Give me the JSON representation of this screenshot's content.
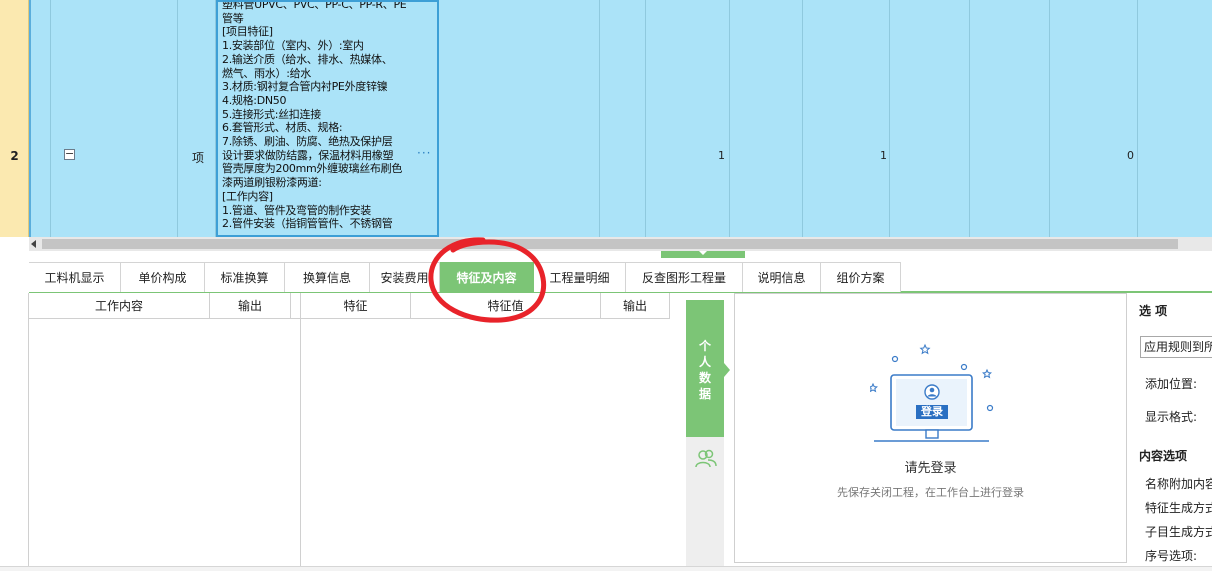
{
  "grid": {
    "row_number": "2",
    "expand_glyph": "−",
    "unit": "项",
    "description": "塑料管UPVC、PVC、PP-C、PP-R、PE\n管等\n[项目特征]\n1.安装部位（室内、外）:室内\n2.输送介质（给水、排水、热媒体、\n燃气、雨水）:给水\n3.材质:钢衬复合管内衬PE外度锌镍\n4.规格:DN50\n5.连接形式:丝扣连接\n6.套管形式、材质、规格:\n7.除锈、刷油、防腐、绝热及保护层\n设计要求做防结露，保温材料用橡塑\n管壳厚度为200mm外缠玻璃丝布刷色\n漆两道刷银粉漆两道:\n[工作内容]\n1.管道、管件及弯管的制作安装\n2.管件安装（指铜管管件、不锈钢管",
    "ellipsis": "···",
    "quantity_1": "1",
    "quantity_2": "1",
    "value_zero": "0"
  },
  "tabs": [
    {
      "label": "工料机显示",
      "active": false
    },
    {
      "label": "单价构成",
      "active": false
    },
    {
      "label": "标准换算",
      "active": false
    },
    {
      "label": "换算信息",
      "active": false
    },
    {
      "label": "安装费用",
      "active": false
    },
    {
      "label": "特征及内容",
      "active": true
    },
    {
      "label": "工程量明细",
      "active": false
    },
    {
      "label": "反查图形工程量",
      "active": false
    },
    {
      "label": "说明信息",
      "active": false
    },
    {
      "label": "组价方案",
      "active": false
    }
  ],
  "work_pane": {
    "col_content": "工作内容",
    "col_output": "输出"
  },
  "feature_pane": {
    "col_feature": "特征",
    "col_value": "特征值",
    "col_output": "输出"
  },
  "side_panel": {
    "personal_data": "个人数据"
  },
  "login": {
    "button": "登录",
    "title": "请先登录",
    "subtitle": "先保存关闭工程，在工作台上进行登录"
  },
  "options": {
    "title": "选 项",
    "select_value": "应用规则到所",
    "add_position": "添加位置:",
    "display_format": "显示格式:",
    "content_options": "内容选项",
    "name_append": "名称附加内容",
    "feature_gen": "特征生成方式",
    "sub_gen": "子目生成方式",
    "serial_option": "序号选项:"
  },
  "colors": {
    "accent_green": "#7cc576",
    "row_blue": "#abe3f8",
    "annotation_red": "#e8232a"
  }
}
